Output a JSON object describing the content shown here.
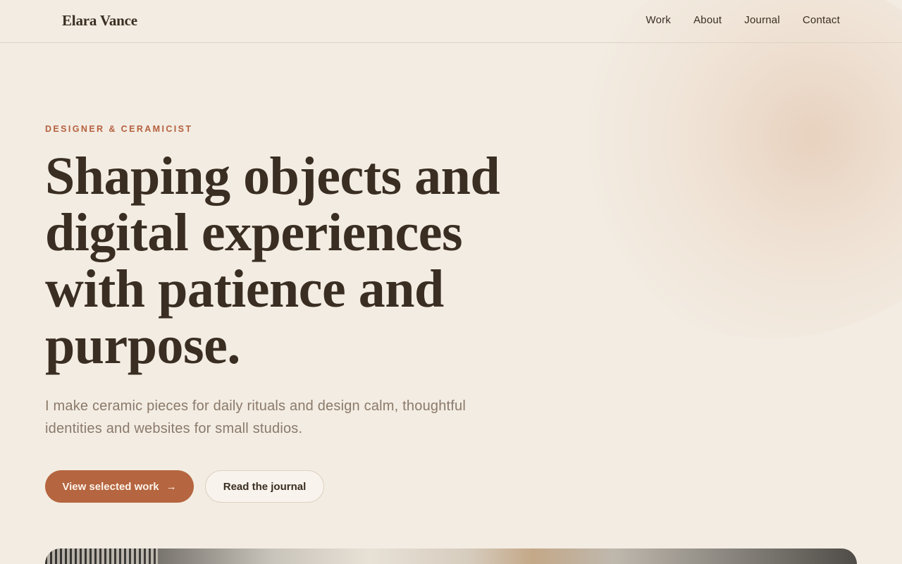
{
  "header": {
    "brand": "Elara Vance",
    "nav": [
      {
        "label": "Work"
      },
      {
        "label": "About"
      },
      {
        "label": "Journal"
      },
      {
        "label": "Contact"
      }
    ]
  },
  "hero": {
    "eyebrow": "DESIGNER & CERAMICIST",
    "title": "Shaping objects and digital experiences with patience and purpose.",
    "lede": "I make ceramic pieces for daily rituals and design calm, thoughtful identities and websites for small studios.",
    "primary_cta": "View selected work",
    "secondary_cta": "Read the journal"
  },
  "colors": {
    "background": "#f3ece2",
    "accent": "#b5653f",
    "text": "#3a2e22",
    "muted": "#8a7a6a"
  },
  "icons": {
    "primary_cta_icon": "arrow-right-icon"
  }
}
